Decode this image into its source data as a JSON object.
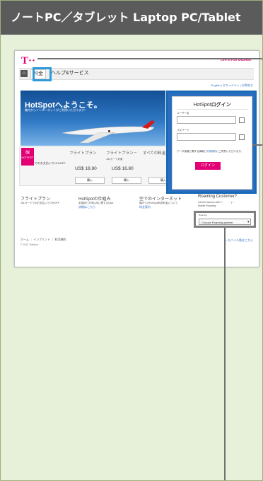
{
  "header": {
    "title": "ノートPC／タブレット  Laptop PC/Tablet"
  },
  "site": {
    "logo": "T··",
    "slogan": "LIFE IS FOR SHARING.",
    "nav": {
      "home_icon": "home-icon",
      "plan_tab": "料金",
      "help_tab": "ヘルプ&サービス"
    },
    "sublinks": "English | セキュリティ | お問合せ"
  },
  "hero": {
    "title": "HotSpotへようこそ。",
    "subtitle": "機内からインターネットがご利用いただけます！",
    "badge": "HOTSPOT"
  },
  "plans": {
    "left_note": "JALカードでのお支払いで10%OFF",
    "items": [
      {
        "name": "フライトプラン",
        "note": "",
        "price": "US$ 18.80",
        "button": "購入"
      },
      {
        "name": "フライトプラン－",
        "note": "JALカード対象",
        "price": "US$ 16.80",
        "button": "購入"
      },
      {
        "name": "すべての料金…",
        "note": "",
        "price": "",
        "button": "購入"
      }
    ]
  },
  "login": {
    "title_prefix": "HotSpot",
    "title_bold": "ログイン",
    "username_label": "ユーザー名",
    "password_label": "パスワード",
    "agree_text": "データ保護に関する情報と",
    "agree_link": "利用規約",
    "agree_suffix": "にご同意いただけます。",
    "button": "ログイン"
  },
  "features": [
    {
      "title": "フライトプラン",
      "desc": "JALカードでのお支払いで10%OFF",
      "link": ""
    },
    {
      "title": "HotSpotの仕組み",
      "desc": "本接続とお申込みに関するQ&A",
      "link": "詳細はこちら"
    },
    {
      "title": "空でのインターネット",
      "desc": "機内でのHotSpot利用料金について",
      "link": "料金案内"
    }
  ],
  "roaming": {
    "title": "Roaming Customer?",
    "subtitle": "Internet access with T-Mobile Roaming",
    "label": "Roaming",
    "select_value": "Choose Roaming partner"
  },
  "footer": {
    "links": "ホーム ｜ インプリント ｜ 利用規約",
    "copyright": "© 2013 Telekom",
    "right_link": "› モバイル版はこちら"
  },
  "colors": {
    "brand": "#e20074",
    "highlight": "#2f9ad8",
    "panel": "#e7f1d9",
    "header": "#5b5b5b"
  }
}
